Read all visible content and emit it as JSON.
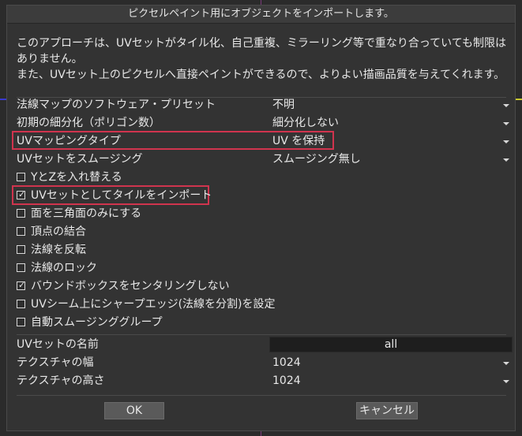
{
  "dialog": {
    "title": "ピクセルペイント用にオブジェクトをインポートします。",
    "description_line1": "このアプローチは、UVセットがタイル化、自己重複、ミラーリング等で重なり合っていても制限は",
    "description_line2": "ありません。",
    "description_line3": "また、UVセット上のピクセルへ直接ペイントができるので、よりよい描画品質を与えてくれます。"
  },
  "options": {
    "normal_preset_label": "法線マップのソフトウェア・プリセット",
    "normal_preset_value": "不明",
    "subdiv_label": "初期の細分化（ポリゴン数）",
    "subdiv_value": "細分化しない",
    "uv_mapping_label": "UVマッピングタイプ",
    "uv_mapping_value": "UV を保持",
    "uv_smoothing_label": "UVセットをスムージング",
    "uv_smoothing_value": "スムージング無し"
  },
  "checkboxes": [
    {
      "label": "YとZを入れ替える",
      "checked": false
    },
    {
      "label": "UVセットとしてタイルをインポート",
      "checked": true
    },
    {
      "label": "面を三角面のみにする",
      "checked": false
    },
    {
      "label": "頂点の結合",
      "checked": false
    },
    {
      "label": "法線を反転",
      "checked": false
    },
    {
      "label": "法線のロック",
      "checked": false
    },
    {
      "label": "バウンドボックスをセンタリングしない",
      "checked": true
    },
    {
      "label": "UVシーム上にシャープエッジ(法線を分割)を設定",
      "checked": false
    },
    {
      "label": "自動スムージンググループ",
      "checked": false
    }
  ],
  "uv_name": {
    "label": "UVセットの名前",
    "value": "all"
  },
  "texture": {
    "width_label": "テクスチャの幅",
    "width_value": "1024",
    "height_label": "テクスチャの高さ",
    "height_value": "1024"
  },
  "buttons": {
    "ok": "OK",
    "cancel": "キャンセル"
  },
  "colors": {
    "highlight": "#d0344e",
    "dialog_bg": "#333333"
  }
}
